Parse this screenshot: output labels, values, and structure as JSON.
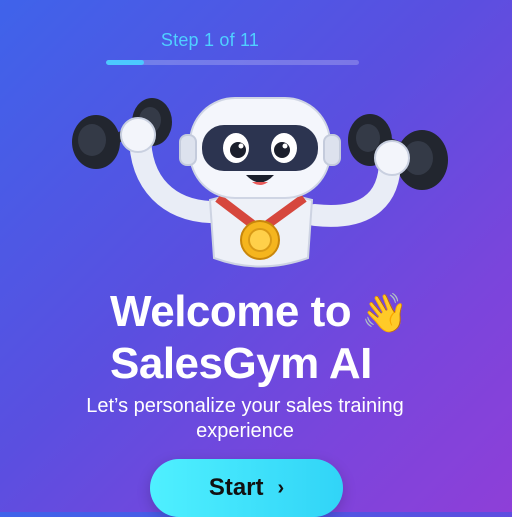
{
  "progress": {
    "label": "Step 1 of 11",
    "current": 1,
    "total": 11,
    "fill_fraction": 0.15
  },
  "hero": {
    "title_line1": "Welcome to",
    "title_line2": "SalesGym AI",
    "wave_emoji": "👋",
    "subtitle": "Let’s personalize your sales training experience"
  },
  "actions": {
    "start_label": "Start",
    "start_icon": "chevron-right-icon"
  },
  "colors": {
    "background_start": "#3f63ea",
    "background_end": "#8e3fd8",
    "accent_cyan": "#4fd0ff",
    "button": "#31d4f7"
  }
}
